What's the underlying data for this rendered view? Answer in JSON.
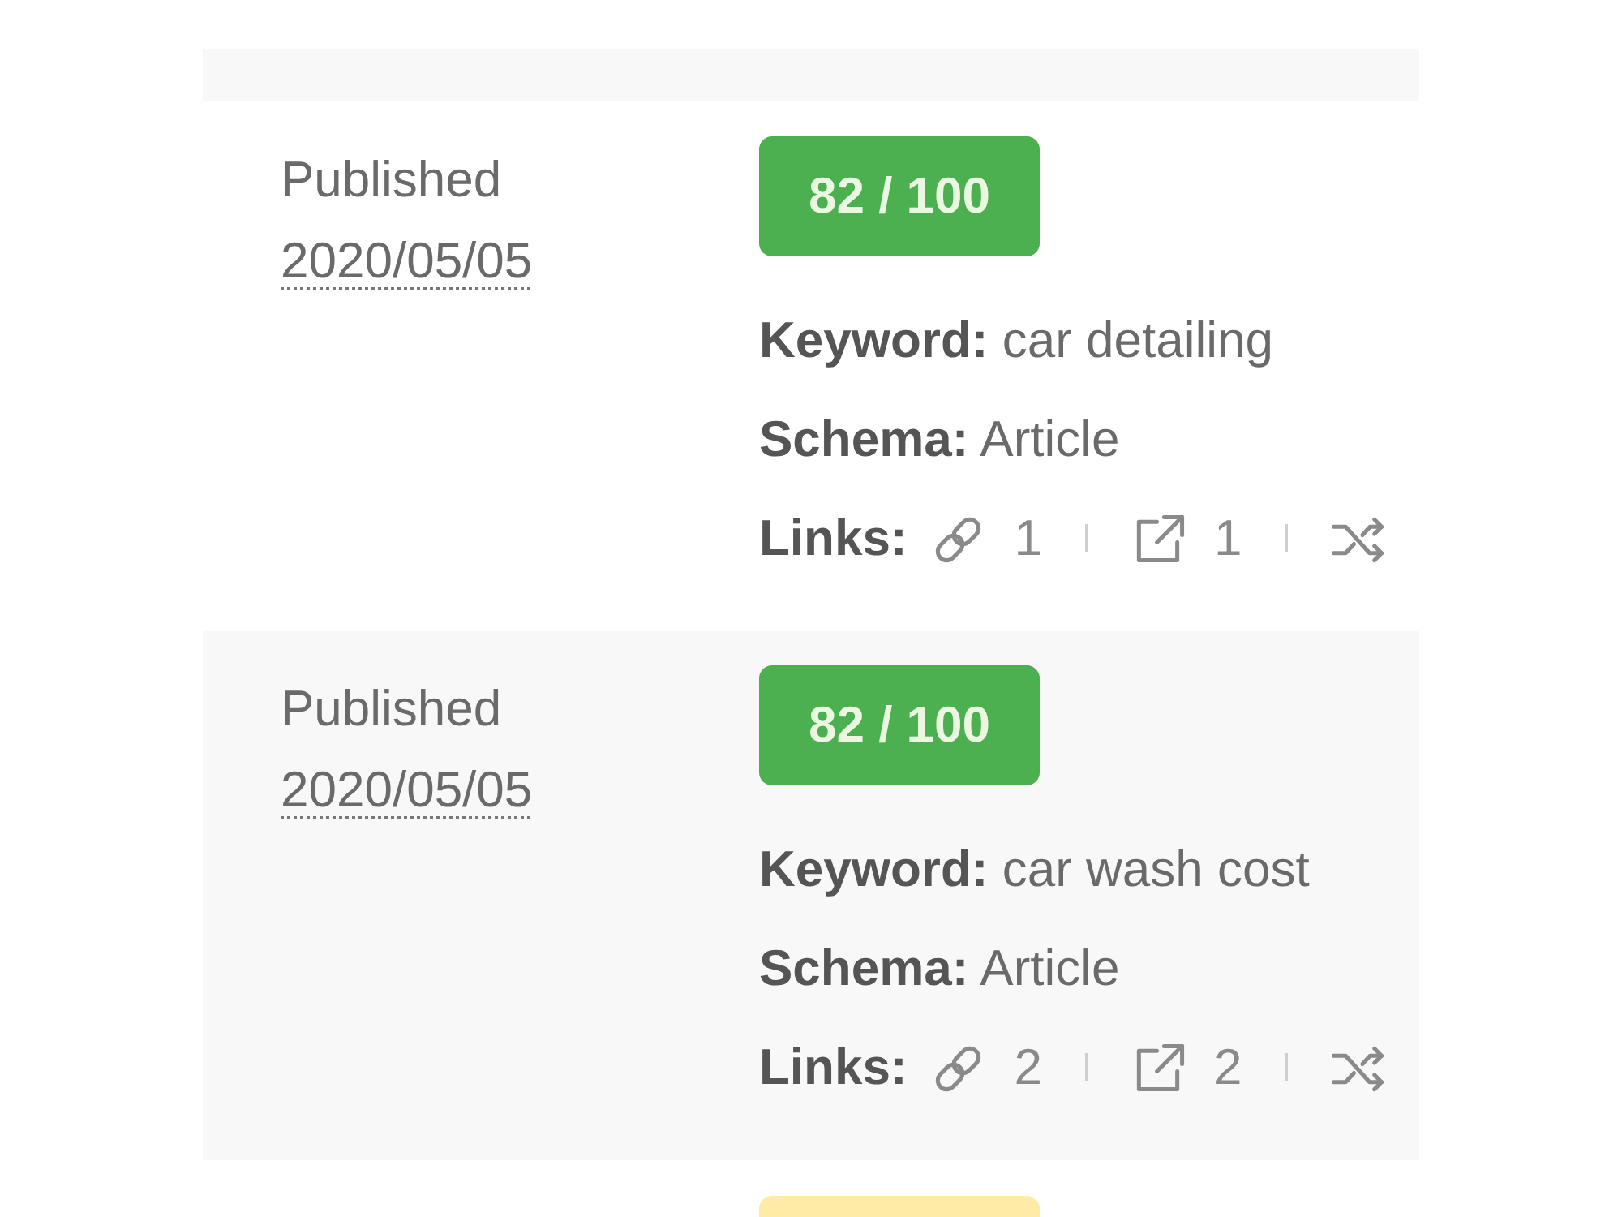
{
  "table": {
    "rows": [
      {
        "status": "Published",
        "date": "2020/05/05",
        "score": {
          "text": "82 / 100",
          "color": "#4caf50"
        },
        "keyword_line": "**Keyword:** car detailing",
        "schema_line": "**Schema:** Article",
        "links": {
          "label": "Links:",
          "items": [
            {
              "kind": "internal",
              "count": "1"
            },
            {
              "kind": "external",
              "count": "1"
            },
            {
              "kind": "incoming"
            }
          ]
        }
      },
      {
        "status": "Published",
        "date": "2020/05/05",
        "score": {
          "text": "82 / 100",
          "color": "#4caf50"
        },
        "keyword_line": "**Keyword:** car wash cost",
        "schema_line": "**Schema:** Article",
        "links": {
          "label": "Links:",
          "items": [
            {
              "kind": "internal",
              "count": "2"
            },
            {
              "kind": "external",
              "count": "2"
            },
            {
              "kind": "incoming"
            }
          ]
        }
      },
      {
        "score": {
          "color": "#ffeaa6"
        }
      }
    ]
  }
}
